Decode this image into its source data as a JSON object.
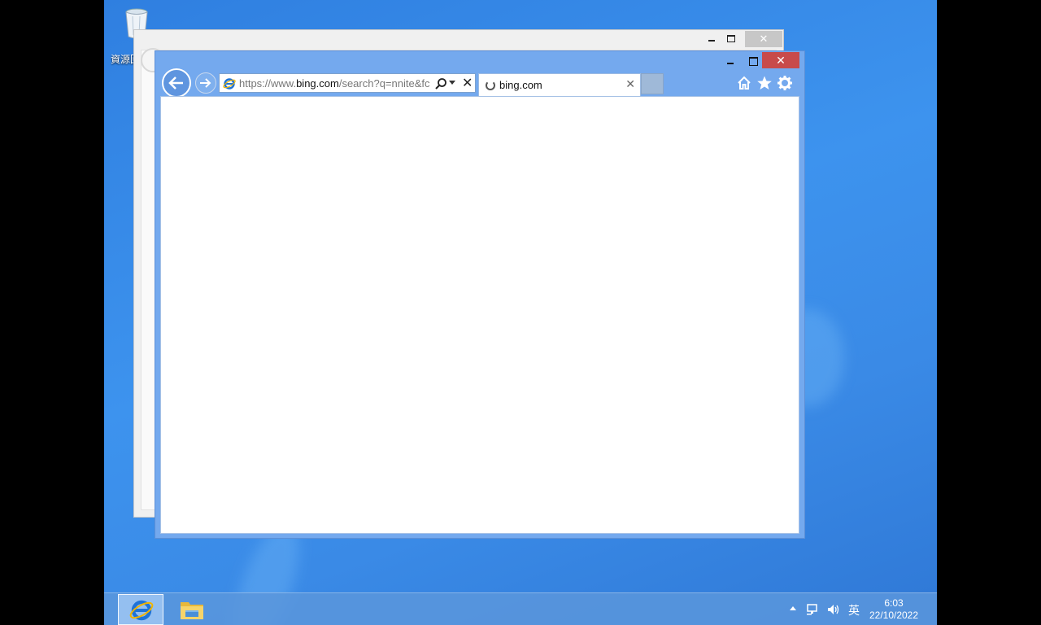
{
  "desktop": {
    "recycle_bin_label": "資源回收筒"
  },
  "back_window": {
    "close_label": "✕"
  },
  "browser": {
    "address_prefix": "https://www.",
    "address_domain": "bing.com",
    "address_rest": "/search?q=nnite&fc",
    "tab_title": "bing.com",
    "tab_close": "✕",
    "address_clear": "✕",
    "close_label": "✕"
  },
  "taskbar": {
    "ime_label": "英",
    "time": "6:03",
    "date": "22/10/2022"
  },
  "colors": {
    "desktop": "#3a8ae6",
    "window_frame": "#74a9ee",
    "close_button": "#c84a4a",
    "taskbar": "#5a96dc"
  }
}
